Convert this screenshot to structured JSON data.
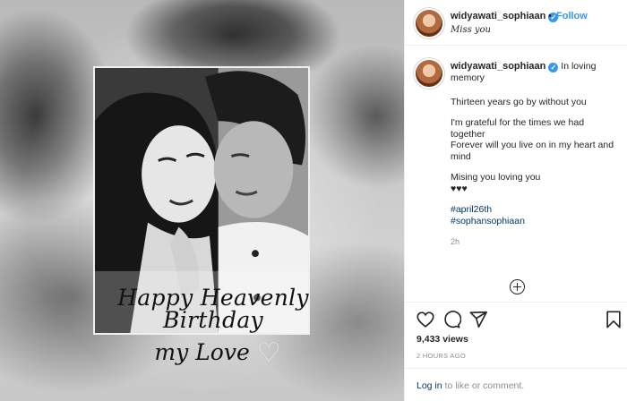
{
  "post": {
    "overlay_line1": "Happy Heavenly Birthday",
    "overlay_line2": "my Love",
    "overlay_heart": "♡"
  },
  "header": {
    "username": "widyawati_sophiaan",
    "separator": "•",
    "follow_label": "Follow",
    "location": "Miss you"
  },
  "caption": {
    "username": "widyawati_sophiaan",
    "first_line": "In loving memory",
    "paragraphs": [
      "Thirteen years go by without you",
      "I'm grateful for the times we had together",
      "Forever will you live on in my heart and mind",
      "Mising you loving you",
      "♥♥♥"
    ],
    "hashtags": [
      "#april26th",
      "#sophansophiaan"
    ],
    "time_ago": "2h"
  },
  "stats": {
    "views": "9,433 views",
    "posted": "2 HOURS AGO"
  },
  "login": {
    "link_label": "Log in",
    "rest": " to like or comment."
  },
  "icons": {
    "like": "heart-icon",
    "comment": "comment-icon",
    "share": "share-icon",
    "save": "bookmark-icon",
    "verified": "verified-badge-icon",
    "load_more": "plus-circle-icon"
  },
  "colors": {
    "link_blue": "#3897f0",
    "hashtag": "#00376b",
    "muted": "#8e8e8e",
    "text": "#262626"
  }
}
